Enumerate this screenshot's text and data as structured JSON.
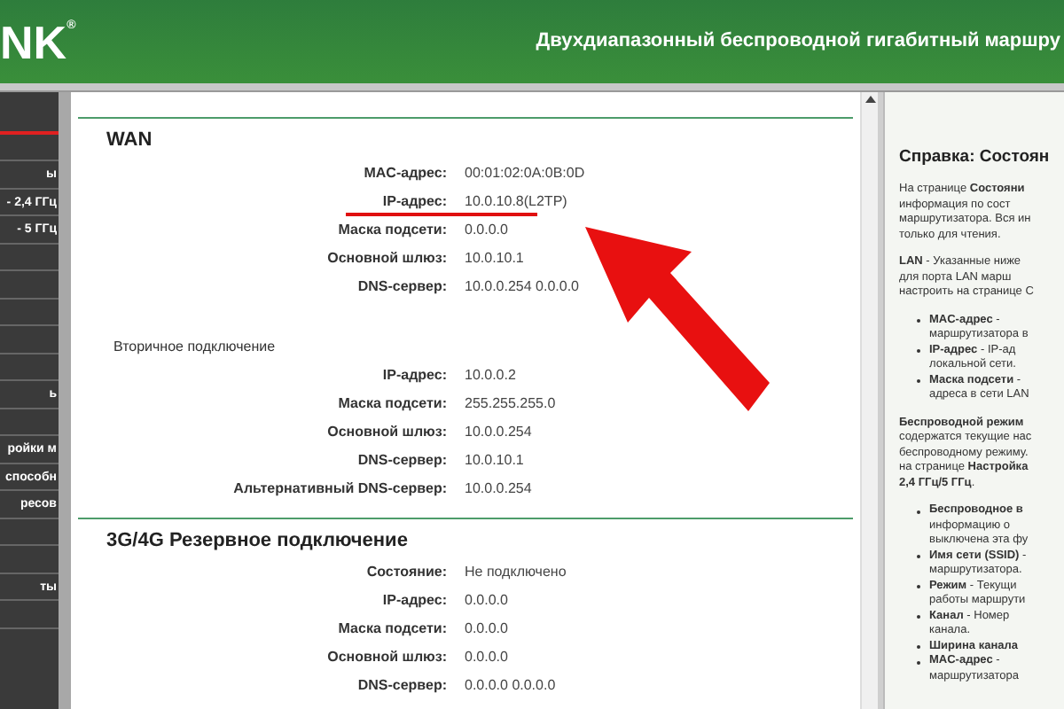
{
  "header": {
    "logo": "NK",
    "logo_mark": "®",
    "title": "Двухдиапазонный беспроводной гигабитный маршру"
  },
  "sidebar": {
    "items": [
      {
        "selected": true
      },
      {
        "selected": false
      },
      {
        "label": "ы",
        "selected": false
      },
      {
        "label": "- 2,4 ГГц",
        "selected": false
      },
      {
        "label": "- 5 ГГц",
        "selected": false
      },
      {
        "selected": false
      },
      {
        "selected": false
      },
      {
        "selected": false
      },
      {
        "selected": false
      },
      {
        "selected": false
      },
      {
        "label": "ь",
        "selected": false
      },
      {
        "selected": false
      },
      {
        "label": "ройки м",
        "selected": false
      },
      {
        "label": "способн",
        "selected": false
      },
      {
        "label": "ресов",
        "selected": false
      },
      {
        "selected": false
      },
      {
        "selected": false
      },
      {
        "label": "ты",
        "selected": false
      },
      {
        "selected": false
      }
    ]
  },
  "sections": [
    {
      "title": "WAN",
      "groups": [
        {
          "rows": [
            {
              "label": "MAC-адрес:",
              "value": "00:01:02:0A:0B:0D"
            },
            {
              "label": "IP-адрес:",
              "value": "10.0.10.8(L2TP)",
              "highlighted": true
            },
            {
              "label": "Маска подсети:",
              "value": "0.0.0.0"
            },
            {
              "label": "Основной шлюз:",
              "value": "10.0.10.1"
            },
            {
              "label": "DNS-сервер:",
              "value": "10.0.0.254 0.0.0.0"
            }
          ]
        },
        {
          "subtitle": "Вторичное подключение",
          "rows": [
            {
              "label": "IP-адрес:",
              "value": "10.0.0.2"
            },
            {
              "label": "Маска подсети:",
              "value": "255.255.255.0"
            },
            {
              "label": "Основной шлюз:",
              "value": "10.0.0.254"
            },
            {
              "label": "DNS-сервер:",
              "value": "10.0.10.1"
            },
            {
              "label": "Альтернативный DNS-сервер:",
              "value": "10.0.0.254"
            }
          ]
        }
      ]
    },
    {
      "title": "3G/4G Резервное подключение",
      "groups": [
        {
          "rows": [
            {
              "label": "Состояние:",
              "value": "Не подключено"
            },
            {
              "label": "IP-адрес:",
              "value": "0.0.0.0"
            },
            {
              "label": "Маска подсети:",
              "value": "0.0.0.0"
            },
            {
              "label": "Основной шлюз:",
              "value": "0.0.0.0"
            },
            {
              "label": "DNS-сервер:",
              "value": "0.0.0.0 0.0.0.0"
            }
          ]
        }
      ]
    }
  ],
  "help": {
    "title": "Справка: Состоян",
    "blocks": [
      {
        "kind": "paragraph",
        "lines": [
          "На странице **Состояни**",
          "информация по сост",
          "маршрутизатора. Вся ин",
          "только для чтения."
        ]
      },
      {
        "kind": "paragraph",
        "lines": [
          "**LAN** - Указанные ниже",
          "для порта LAN марш",
          "настроить на странице С"
        ]
      },
      {
        "kind": "bullet",
        "lines": [
          "**MAC-адрес** -",
          "маршрутизатора в"
        ]
      },
      {
        "kind": "bullet",
        "lines": [
          "**IP-адрес** - IP-ад",
          "локальной сети."
        ]
      },
      {
        "kind": "bullet",
        "lines": [
          "**Маска подсети** -",
          "адреса в сети LAN"
        ]
      },
      {
        "kind": "paragraph",
        "lines": [
          "**Беспроводной режим**",
          "содержатся текущие нас",
          "беспроводному режиму.",
          "на странице **Настройка**",
          "**2,4 ГГц/5 ГГц**."
        ]
      },
      {
        "kind": "bullet",
        "lines": [
          "**Беспроводное в**",
          "информацию о",
          "выключена эта фу"
        ]
      },
      {
        "kind": "bullet",
        "lines": [
          "**Имя сети (SSID)** -",
          "маршрутизатора."
        ]
      },
      {
        "kind": "bullet",
        "lines": [
          "**Режим** - Текущи",
          "работы маршрути"
        ]
      },
      {
        "kind": "bullet",
        "lines": [
          "**Канал** - Номер",
          "канала."
        ]
      },
      {
        "kind": "bullet",
        "lines": [
          "**Ширина канала**"
        ]
      },
      {
        "kind": "bullet",
        "lines": [
          "**MAC-адрес** -",
          "маршрутизатора"
        ]
      }
    ]
  }
}
